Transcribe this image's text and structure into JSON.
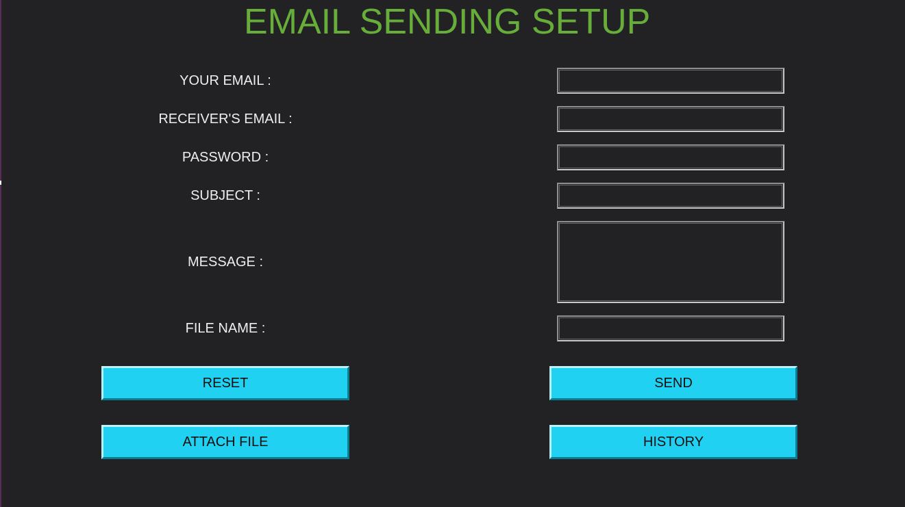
{
  "header": {
    "title": "EMAIL SENDING SETUP"
  },
  "form": {
    "your_email": {
      "label": "YOUR EMAIL :",
      "value": ""
    },
    "receiver_email": {
      "label": "RECEIVER'S EMAIL :",
      "value": ""
    },
    "password": {
      "label": "PASSWORD :",
      "value": ""
    },
    "subject": {
      "label": "SUBJECT :",
      "value": ""
    },
    "message": {
      "label": "MESSAGE :",
      "value": ""
    },
    "file_name": {
      "label": "FILE NAME :",
      "value": ""
    }
  },
  "buttons": {
    "reset": "RESET",
    "send": "SEND",
    "attach_file": "ATTACH FILE",
    "history": "HISTORY"
  },
  "colors": {
    "background": "#222124",
    "title": "#67ad3a",
    "button": "#20d1f2",
    "label_text": "#eeeeee"
  }
}
